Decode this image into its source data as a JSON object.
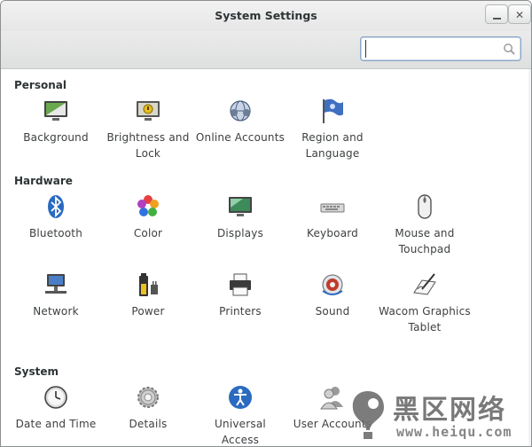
{
  "window": {
    "title": "System Settings"
  },
  "search": {
    "value": "",
    "placeholder": ""
  },
  "sections": {
    "personal": {
      "title": "Personal",
      "items": [
        {
          "label": "Background"
        },
        {
          "label": "Brightness and Lock"
        },
        {
          "label": "Online Accounts"
        },
        {
          "label": "Region and Language"
        }
      ]
    },
    "hardware": {
      "title": "Hardware",
      "items": [
        {
          "label": "Bluetooth"
        },
        {
          "label": "Color"
        },
        {
          "label": "Displays"
        },
        {
          "label": "Keyboard"
        },
        {
          "label": "Mouse and Touchpad"
        },
        {
          "label": "Network"
        },
        {
          "label": "Power"
        },
        {
          "label": "Printers"
        },
        {
          "label": "Sound"
        },
        {
          "label": "Wacom Graphics Tablet"
        }
      ]
    },
    "system": {
      "title": "System",
      "items": [
        {
          "label": "Date and Time"
        },
        {
          "label": "Details"
        },
        {
          "label": "Universal Access"
        },
        {
          "label": "User Accounts"
        }
      ]
    }
  },
  "watermark": {
    "text": "黑区网络",
    "url": "www.heiqu.com"
  }
}
